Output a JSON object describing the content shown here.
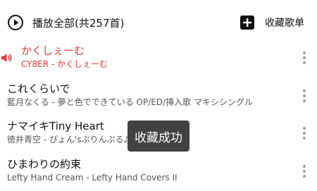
{
  "header": {
    "play_all_label": "播放全部(共257首)",
    "play_icon": "play-circle-icon",
    "collect_label": "收藏歌单",
    "collect_icon": "plus-square-icon"
  },
  "songs": [
    {
      "title": "かくしぇーむ",
      "subtitle": "CY8ER - かくしぇーむ",
      "playing": true
    },
    {
      "title": "これくらいで",
      "subtitle": "藍月なくる - 夢と色でできている OP/ED/挿入歌 マキシシングル",
      "playing": false
    },
    {
      "title": "ナマイキTiny Heart",
      "subtitle": "徳井青空 - ぴょん'sぷりんぷる♪",
      "playing": false
    },
    {
      "title": "ひまわりの約束",
      "subtitle": "Lefty Hand Cream - Lefty Hand Covers II",
      "playing": false
    }
  ],
  "toast": {
    "message": "收藏成功"
  },
  "colors": {
    "accent": "#e53935",
    "text_primary": "#111111",
    "text_secondary": "#555555",
    "more_dots": "#9e9e9e",
    "toast_bg": "#323232"
  }
}
